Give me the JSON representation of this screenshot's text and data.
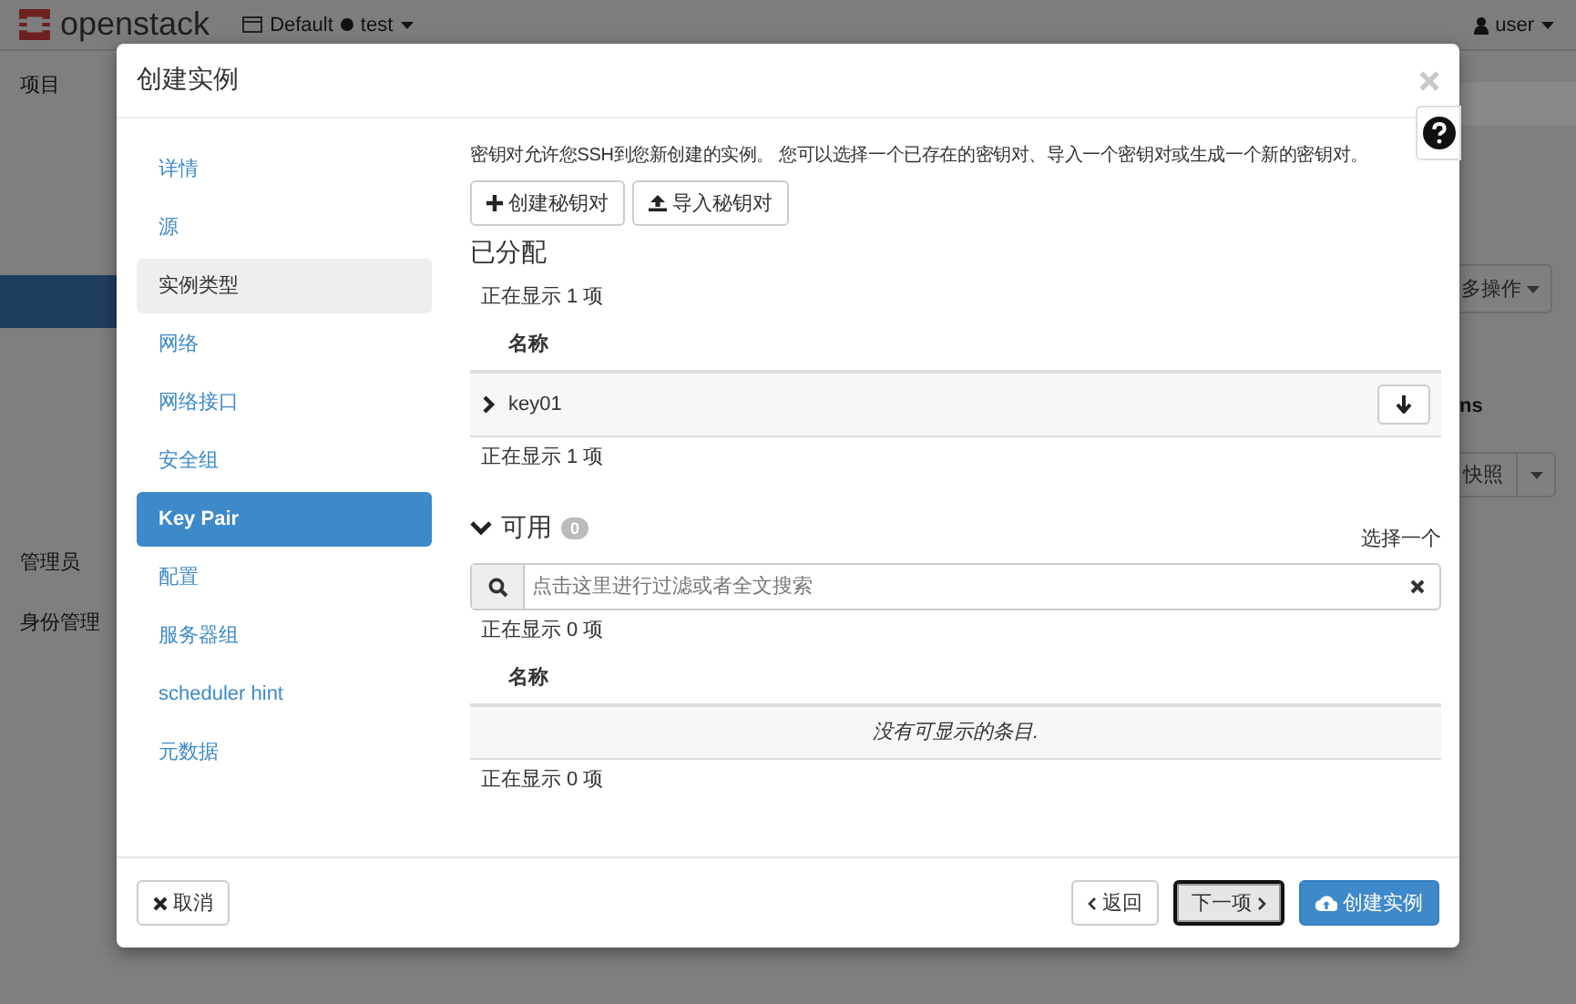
{
  "topbar": {
    "brand": "openstack",
    "domain": "Default",
    "project": "test",
    "user": "user"
  },
  "background_nav": [
    {
      "label": "项目",
      "selected": false
    },
    {
      "selected": true
    },
    {
      "label": "管理员",
      "selected": false
    },
    {
      "label": "身份管理",
      "selected": false
    }
  ],
  "background_content": {
    "actions_button": "多操作",
    "column_fragment": "ns",
    "snapshot_button": "快照"
  },
  "modal": {
    "title": "创建实例",
    "steps": [
      {
        "label": "详情",
        "selected": false,
        "hovered": false
      },
      {
        "label": "源",
        "selected": false,
        "hovered": false
      },
      {
        "label": "实例类型",
        "selected": false,
        "hovered": true
      },
      {
        "label": "网络",
        "selected": false,
        "hovered": false
      },
      {
        "label": "网络接口",
        "selected": false,
        "hovered": false
      },
      {
        "label": "安全组",
        "selected": false,
        "hovered": false
      },
      {
        "label": "Key Pair",
        "selected": true,
        "hovered": false
      },
      {
        "label": "配置",
        "selected": false,
        "hovered": false
      },
      {
        "label": "服务器组",
        "selected": false,
        "hovered": false
      },
      {
        "label": "scheduler hint",
        "selected": false,
        "hovered": false
      },
      {
        "label": "元数据",
        "selected": false,
        "hovered": false
      }
    ],
    "description": "密钥对允许您SSH到您新创建的实例。 您可以选择一个已存在的密钥对、导入一个密钥对或生成一个新的密钥对。",
    "actions": [
      {
        "kind": "create",
        "label": "创建秘钥对"
      },
      {
        "kind": "import",
        "label": "导入秘钥对"
      }
    ],
    "allocated": {
      "title": "已分配",
      "count_top": "正在显示 1 项",
      "column": "名称",
      "rows": [
        {
          "name": "key01",
          "expanded": false
        }
      ],
      "count_bottom": "正在显示 1 项"
    },
    "available": {
      "title": "可用",
      "expanded": true,
      "badge": "0",
      "select_label": "选择一个",
      "search": {
        "placeholder": "点击这里进行过滤或者全文搜索"
      },
      "count_top": "正在显示 0 项",
      "column": "名称",
      "empty_text": "没有可显示的条目.",
      "count_bottom": "正在显示 0 项"
    },
    "footer": [
      {
        "kind": "cancel",
        "label": "取消",
        "focused": false
      },
      {
        "kind": "back",
        "label": "返回",
        "focused": false
      },
      {
        "kind": "next",
        "label": "下一项",
        "focused": true
      },
      {
        "kind": "launch",
        "label": "创建实例",
        "focused": false
      }
    ]
  }
}
